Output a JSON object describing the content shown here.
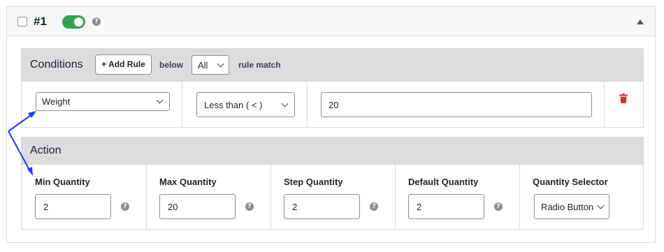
{
  "rule": {
    "number": "#1",
    "checkbox_checked": false,
    "enabled": true,
    "toggle_color": "#2ea44f"
  },
  "conditions": {
    "title": "Conditions",
    "add_rule_label": "+ Add Rule",
    "below_text": "below",
    "match_value": "All",
    "match_suffix": "rule match",
    "row": {
      "field": "Weight",
      "operator": "Less than ( < )",
      "value": "20"
    },
    "delete_icon_color": "#d63638"
  },
  "action": {
    "title": "Action",
    "fields": [
      {
        "label": "Min Quantity",
        "value": "2"
      },
      {
        "label": "Max Quantity",
        "value": "20"
      },
      {
        "label": "Step Quantity",
        "value": "2"
      },
      {
        "label": "Default Quantity",
        "value": "2"
      }
    ],
    "selector": {
      "label": "Quantity Selector",
      "value": "Radio Button"
    }
  },
  "annotation_color": "#1a3cff"
}
